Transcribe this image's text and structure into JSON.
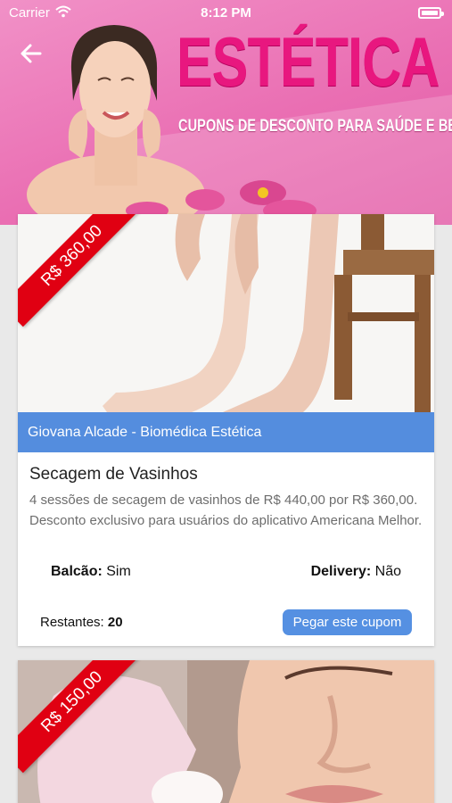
{
  "status_bar": {
    "carrier": "Carrier",
    "time": "8:12 PM"
  },
  "banner": {
    "title": "ESTÉTICA",
    "subtitle": "CUPONS DE DESCONTO PARA SAÚDE E BELEZA",
    "title_color": "#e8177f",
    "background_color": "#ea6fb3"
  },
  "coupons": [
    {
      "price_tag": "R$ 360,00",
      "provider": "Giovana Alcade - Biomédica Estética",
      "title": "Secagem de Vasinhos",
      "description": "4 sessões de secagem de vasinhos de R$ 440,00 por R$ 360,00. Desconto exclusivo para usuários do aplicativo Americana Melhor.",
      "counter_label": "Balcão:",
      "counter_value": "Sim",
      "delivery_label": "Delivery:",
      "delivery_value": "Não",
      "remaining_label": "Restantes:",
      "remaining_value": "20",
      "button_label": "Pegar este cupom"
    },
    {
      "price_tag": "R$ 150,00"
    }
  ],
  "colors": {
    "ribbon": "#e00012",
    "provider_bar": "#548dde",
    "button": "#5590e2"
  }
}
